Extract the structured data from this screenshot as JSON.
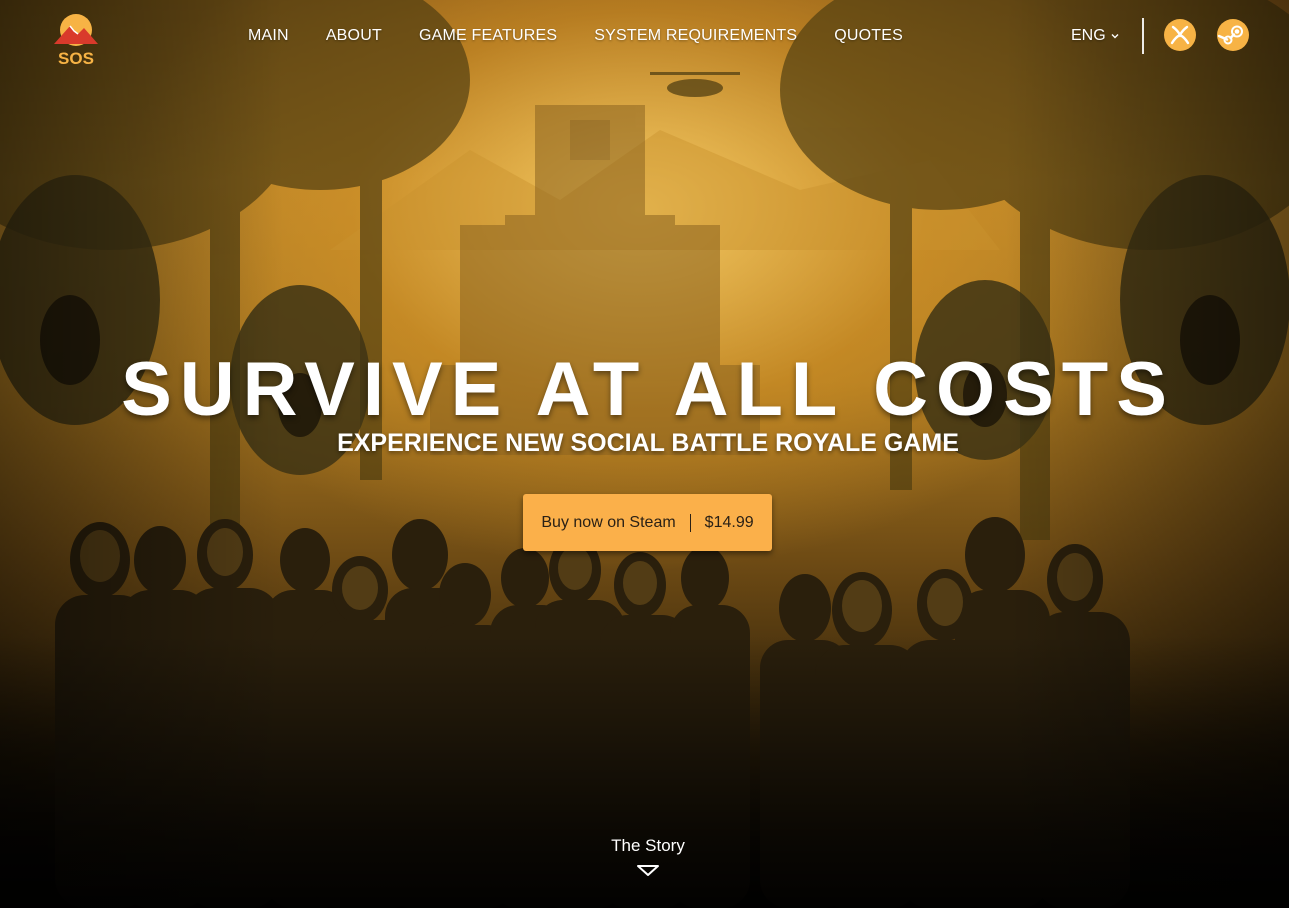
{
  "header": {
    "logo_text": "SOS",
    "nav": [
      {
        "label": "MAIN"
      },
      {
        "label": "ABOUT"
      },
      {
        "label": "GAME FEATURES"
      },
      {
        "label": "SYSTEM REQUIREMENTS"
      },
      {
        "label": "QUOTES"
      }
    ],
    "language": "ENG",
    "platforms": [
      {
        "icon": "xbox-icon"
      },
      {
        "icon": "steam-icon"
      }
    ]
  },
  "hero": {
    "title": "SURVIVE AT ALL COSTS",
    "subtitle": "EXPERIENCE NEW SOCIAL BATTLE ROYALE GAME",
    "buy_label": "Buy now on Steam",
    "price": "$14.99"
  },
  "story": {
    "label": "The Story"
  },
  "colors": {
    "accent": "#fbb04a",
    "text": "#ffffff",
    "logo_red": "#d93a2b"
  }
}
